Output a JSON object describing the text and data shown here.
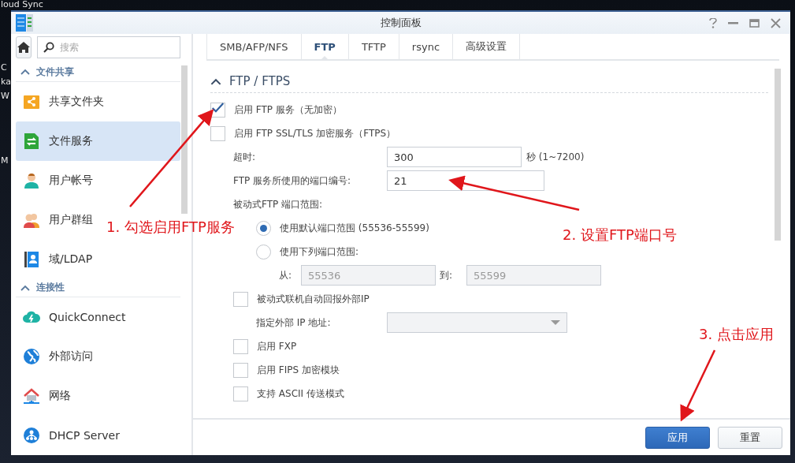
{
  "desktop": {
    "texts": [
      "loud Sync",
      "C",
      "ka",
      "W",
      "M"
    ]
  },
  "window": {
    "title": "控制面板"
  },
  "sidebar": {
    "search": {
      "placeholder": "搜索"
    },
    "sections": [
      {
        "title": "文件共享",
        "expanded": true,
        "items": [
          {
            "label": "共享文件夹",
            "selected": false
          },
          {
            "label": "文件服务",
            "selected": true
          },
          {
            "label": "用户帐号",
            "selected": false
          },
          {
            "label": "用户群组",
            "selected": false
          },
          {
            "label": "域/LDAP",
            "selected": false
          }
        ]
      },
      {
        "title": "连接性",
        "expanded": true,
        "items": [
          {
            "label": "QuickConnect",
            "selected": false
          },
          {
            "label": "外部访问",
            "selected": false
          },
          {
            "label": "网络",
            "selected": false
          },
          {
            "label": "DHCP Server",
            "selected": false
          }
        ]
      }
    ]
  },
  "tabs": [
    {
      "label": "SMB/AFP/NFS",
      "selected": false
    },
    {
      "label": "FTP",
      "selected": true
    },
    {
      "label": "TFTP",
      "selected": false
    },
    {
      "label": "rsync",
      "selected": false
    },
    {
      "label": "高级设置",
      "selected": false
    }
  ],
  "section": {
    "title": "FTP / FTPS",
    "expanded": true
  },
  "rows": [
    {
      "kind": "checkbox",
      "label": "启用 FTP 服务（无加密）",
      "checked": true
    },
    {
      "kind": "checkbox",
      "label": "启用 FTP SSL/TLS 加密服务（FTPS）",
      "checked": false,
      "children": [
        {
          "kind": "field",
          "label": "超时:",
          "value": "300",
          "suffix": "秒 (1~7200)"
        },
        {
          "kind": "field",
          "label": "FTP 服务所使用的端口编号:",
          "value": "21"
        },
        {
          "kind": "heading",
          "label": "被动式FTP 端口范围:",
          "children": [
            {
              "kind": "radio",
              "label": "使用默认端口范围 (55536-55599)",
              "selected": true
            },
            {
              "kind": "radio",
              "label": "使用下列端口范围:",
              "selected": false,
              "children": [
                {
                  "kind": "range",
                  "from_label": "从:",
                  "from": "55536",
                  "to_label": "到:",
                  "to": "55599",
                  "disabled": true
                }
              ]
            }
          ]
        },
        {
          "kind": "checkbox",
          "label": "被动式联机自动回报外部IP",
          "checked": false,
          "children": [
            {
              "kind": "select",
              "label": "指定外部 IP 地址:",
              "disabled": true
            }
          ]
        },
        {
          "kind": "checkbox",
          "label": "启用 FXP",
          "checked": false
        },
        {
          "kind": "checkbox",
          "label": "启用 FIPS 加密模块",
          "checked": false
        },
        {
          "kind": "checkbox",
          "label": "支持 ASCII 传送模式",
          "checked": false
        }
      ]
    }
  ],
  "buttons": [
    {
      "label": "应用",
      "kind": "primary"
    },
    {
      "label": "重置",
      "kind": "secondary"
    }
  ],
  "annotations": [
    {
      "text": "1. 勾选启用FTP服务"
    },
    {
      "text": "2. 设置FTP端口号"
    },
    {
      "text": "3. 点击应用"
    }
  ]
}
